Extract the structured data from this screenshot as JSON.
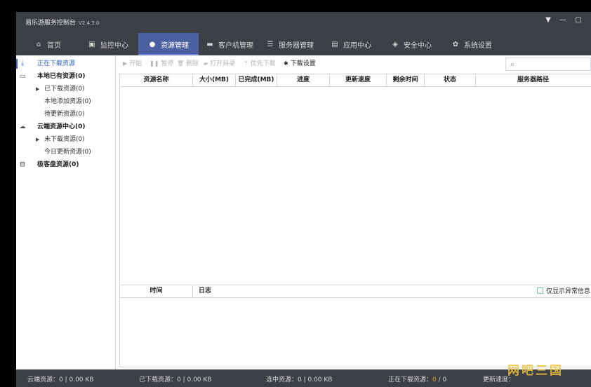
{
  "app": {
    "title": "易乐游服务控制台",
    "version": "V2.4.3.0"
  },
  "nav": {
    "tabs": [
      {
        "label": "首页",
        "icon": "home-icon"
      },
      {
        "label": "监控中心",
        "icon": "monitor-chart-icon"
      },
      {
        "label": "资源管理",
        "icon": "robot-icon",
        "active": true
      },
      {
        "label": "客户机管理",
        "icon": "desktop-icon"
      },
      {
        "label": "服务器管理",
        "icon": "server-icon"
      },
      {
        "label": "应用中心",
        "icon": "app-box-icon"
      },
      {
        "label": "安全中心",
        "icon": "shield-icon"
      },
      {
        "label": "系统设置",
        "icon": "gear-icon"
      }
    ]
  },
  "sidebar": {
    "items": [
      {
        "label": "正在下载资源",
        "icon": "download-icon"
      },
      {
        "label": "本地已有资源(0)",
        "icon": "folder-icon"
      },
      {
        "label": "已下载资源(0)"
      },
      {
        "label": "本地添加资源(0)"
      },
      {
        "label": "待更新资源(0)"
      },
      {
        "label": "云端资源中心(0)",
        "icon": "cloud-icon"
      },
      {
        "label": "未下载资源(0)"
      },
      {
        "label": "今日更新资源(0)"
      },
      {
        "label": "极客盘资源(0)",
        "icon": "disk-icon"
      }
    ]
  },
  "toolbar": {
    "start": "开始",
    "pause": "暂停",
    "delete": "删除",
    "open_dir": "打开目录",
    "priority": "优先下载",
    "settings": "下载设置"
  },
  "search": {
    "placeholder": ""
  },
  "table": {
    "columns": [
      "资源名称",
      "大小(MB)",
      "已完成(MB)",
      "进度",
      "更新速度",
      "剩余时间",
      "状态",
      "服务器路径"
    ],
    "rows": []
  },
  "log": {
    "columns": [
      "时间",
      "日志"
    ],
    "only_errors_label": "仅显示异常信息"
  },
  "status": {
    "cloud": "云端资源：0 | 0.00 KB",
    "downloaded": "已下载资源：0 | 0.00 KB",
    "selected": "选中资源：0 | 0.00 KB",
    "downloading_label": "正在下载资源：",
    "downloading_current": "0",
    "downloading_total": "/ 0",
    "speed": "更新速度："
  },
  "watermark": "网吧三国",
  "colors": {
    "titlebar": "#3c3f45",
    "active_tab": "#4c5fa0",
    "accent": "#2b63c6",
    "highlight": "#e59a2d"
  }
}
